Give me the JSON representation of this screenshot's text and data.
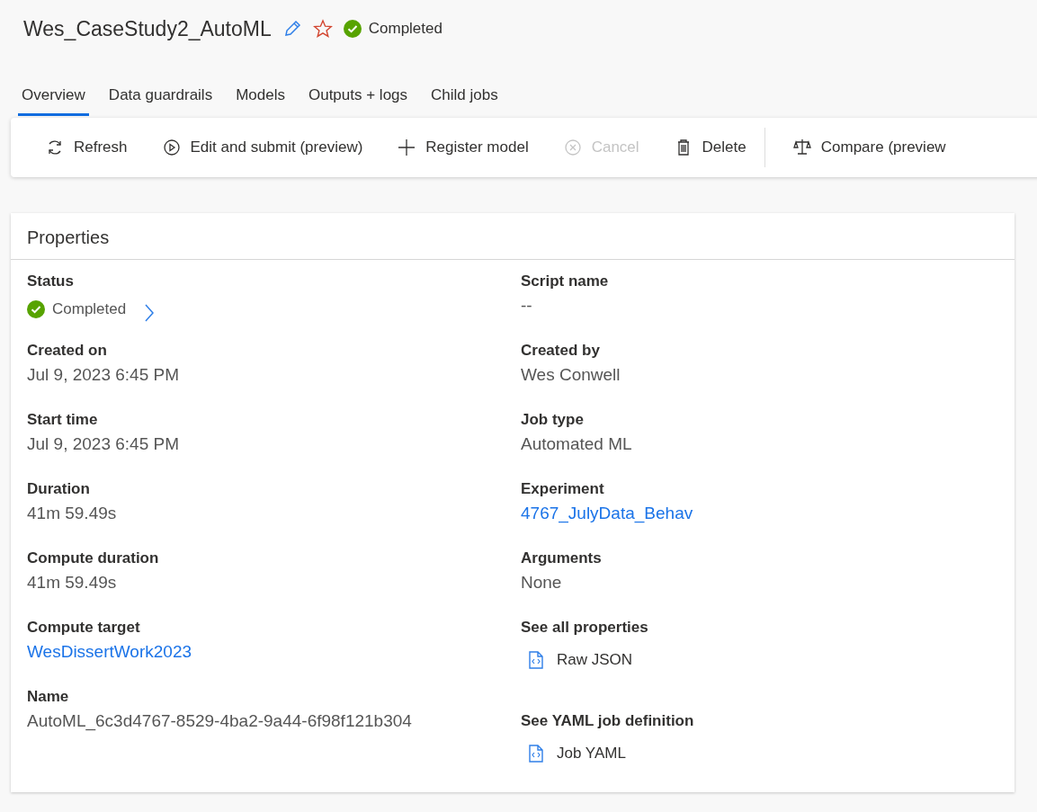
{
  "header": {
    "title": "Wes_CaseStudy2_AutoML",
    "status": "Completed"
  },
  "tabs": [
    {
      "label": "Overview",
      "selected": true
    },
    {
      "label": "Data guardrails",
      "selected": false
    },
    {
      "label": "Models",
      "selected": false
    },
    {
      "label": "Outputs + logs",
      "selected": false
    },
    {
      "label": "Child jobs",
      "selected": false
    }
  ],
  "toolbar": {
    "actions": [
      {
        "kind": "refresh",
        "label": "Refresh",
        "disabled": false
      },
      {
        "kind": "play",
        "label": "Edit and submit (preview)",
        "disabled": false
      },
      {
        "kind": "plus",
        "label": "Register model",
        "disabled": false
      },
      {
        "kind": "cancel",
        "label": "Cancel",
        "disabled": true
      },
      {
        "kind": "trash",
        "label": "Delete",
        "disabled": false
      }
    ],
    "secondary_actions": [
      {
        "kind": "scale",
        "label": "Compare (preview",
        "disabled": false
      }
    ]
  },
  "properties": {
    "title": "Properties",
    "left": [
      {
        "kind": "status",
        "label": "Status",
        "value": "Completed"
      },
      {
        "kind": "text",
        "label": "Created on",
        "value": "Jul 9, 2023 6:45 PM"
      },
      {
        "kind": "text",
        "label": "Start time",
        "value": "Jul 9, 2023 6:45 PM"
      },
      {
        "kind": "text",
        "label": "Duration",
        "value": "41m 59.49s"
      },
      {
        "kind": "text",
        "label": "Compute duration",
        "value": "41m 59.49s"
      },
      {
        "kind": "link",
        "label": "Compute target",
        "value": "WesDissertWork2023"
      },
      {
        "kind": "text",
        "label": "Name",
        "value": "AutoML_6c3d4767-8529-4ba2-9a44-6f98f121b304"
      }
    ],
    "right": [
      {
        "kind": "text",
        "label": "Script name",
        "value": "--"
      },
      {
        "kind": "text",
        "label": "Created by",
        "value": "Wes Conwell"
      },
      {
        "kind": "text",
        "label": "Job type",
        "value": "Automated ML"
      },
      {
        "kind": "link",
        "label": "Experiment",
        "value": "4767_JulyData_Behav"
      },
      {
        "kind": "text",
        "label": "Arguments",
        "value": "None"
      },
      {
        "kind": "file",
        "label": "See all properties",
        "value": "Raw JSON"
      },
      {
        "kind": "file",
        "label": "See YAML job definition",
        "value": "Job YAML"
      }
    ]
  }
}
